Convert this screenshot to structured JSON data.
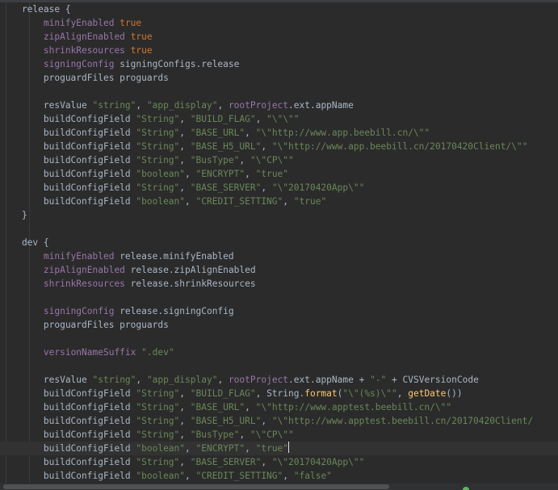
{
  "window": {
    "title": ""
  },
  "colors": {
    "background": "#2b2b2b",
    "default": "#a9b7c6",
    "keyword": "#cc7832",
    "property": "#9876aa",
    "string": "#6a8759",
    "method": "#ffc66d",
    "caret_line": "#323232"
  },
  "editor": {
    "active_line_index": 32,
    "lines": [
      [
        [
          "    release {",
          "default"
        ]
      ],
      [
        [
          "        ",
          "default"
        ],
        [
          "minifyEnabled",
          "property"
        ],
        [
          " ",
          "default"
        ],
        [
          "true",
          "keyword"
        ]
      ],
      [
        [
          "        ",
          "default"
        ],
        [
          "zipAlignEnabled",
          "property"
        ],
        [
          " ",
          "default"
        ],
        [
          "true",
          "keyword"
        ]
      ],
      [
        [
          "        ",
          "default"
        ],
        [
          "shrinkResources",
          "property"
        ],
        [
          " ",
          "default"
        ],
        [
          "true",
          "keyword"
        ]
      ],
      [
        [
          "        ",
          "default"
        ],
        [
          "signingConfig",
          "property"
        ],
        [
          " signingConfigs.release",
          "default"
        ]
      ],
      [
        [
          "        proguardFiles proguards",
          "default"
        ]
      ],
      [
        [
          "",
          "default"
        ]
      ],
      [
        [
          "        resValue ",
          "default"
        ],
        [
          "\"string\"",
          "string"
        ],
        [
          ", ",
          "default"
        ],
        [
          "\"app_display\"",
          "string"
        ],
        [
          ", ",
          "default"
        ],
        [
          "rootProject",
          "property"
        ],
        [
          ".ext.appName",
          "default"
        ]
      ],
      [
        [
          "        buildConfigField ",
          "default"
        ],
        [
          "\"String\"",
          "string"
        ],
        [
          ", ",
          "default"
        ],
        [
          "\"BUILD_FLAG\"",
          "string"
        ],
        [
          ", ",
          "default"
        ],
        [
          "\"\\\"\\\"\"",
          "string"
        ]
      ],
      [
        [
          "        buildConfigField ",
          "default"
        ],
        [
          "\"String\"",
          "string"
        ],
        [
          ", ",
          "default"
        ],
        [
          "\"BASE_URL\"",
          "string"
        ],
        [
          ", ",
          "default"
        ],
        [
          "\"\\\"http://www.app.beebill.cn/\\\"\"",
          "string"
        ]
      ],
      [
        [
          "        buildConfigField ",
          "default"
        ],
        [
          "\"String\"",
          "string"
        ],
        [
          ", ",
          "default"
        ],
        [
          "\"BASE_H5_URL\"",
          "string"
        ],
        [
          ", ",
          "default"
        ],
        [
          "\"\\\"http://www.app.beebill.cn/20170420Client/\\\"\"",
          "string"
        ]
      ],
      [
        [
          "        buildConfigField ",
          "default"
        ],
        [
          "\"String\"",
          "string"
        ],
        [
          ", ",
          "default"
        ],
        [
          "\"BusType\"",
          "string"
        ],
        [
          ", ",
          "default"
        ],
        [
          "\"\\\"CP\\\"\"",
          "string"
        ]
      ],
      [
        [
          "        buildConfigField ",
          "default"
        ],
        [
          "\"boolean\"",
          "string"
        ],
        [
          ", ",
          "default"
        ],
        [
          "\"ENCRYPT\"",
          "string"
        ],
        [
          ", ",
          "default"
        ],
        [
          "\"true\"",
          "string"
        ]
      ],
      [
        [
          "        buildConfigField ",
          "default"
        ],
        [
          "\"String\"",
          "string"
        ],
        [
          ", ",
          "default"
        ],
        [
          "\"BASE_SERVER\"",
          "string"
        ],
        [
          ", ",
          "default"
        ],
        [
          "\"\\\"20170420App\\\"\"",
          "string"
        ]
      ],
      [
        [
          "        buildConfigField ",
          "default"
        ],
        [
          "\"boolean\"",
          "string"
        ],
        [
          ", ",
          "default"
        ],
        [
          "\"CREDIT_SETTING\"",
          "string"
        ],
        [
          ", ",
          "default"
        ],
        [
          "\"true\"",
          "string"
        ]
      ],
      [
        [
          "    }",
          "default"
        ]
      ],
      [
        [
          "",
          "default"
        ]
      ],
      [
        [
          "    dev {",
          "default"
        ]
      ],
      [
        [
          "        ",
          "default"
        ],
        [
          "minifyEnabled",
          "property"
        ],
        [
          " release.minifyEnabled",
          "default"
        ]
      ],
      [
        [
          "        ",
          "default"
        ],
        [
          "zipAlignEnabled",
          "property"
        ],
        [
          " release.zipAlignEnabled",
          "default"
        ]
      ],
      [
        [
          "        ",
          "default"
        ],
        [
          "shrinkResources",
          "property"
        ],
        [
          " release.shrinkResources",
          "default"
        ]
      ],
      [
        [
          "",
          "default"
        ]
      ],
      [
        [
          "        ",
          "default"
        ],
        [
          "signingConfig",
          "property"
        ],
        [
          " release.signingConfig",
          "default"
        ]
      ],
      [
        [
          "        proguardFiles proguards",
          "default"
        ]
      ],
      [
        [
          "",
          "default"
        ]
      ],
      [
        [
          "        ",
          "default"
        ],
        [
          "versionNameSuffix",
          "property"
        ],
        [
          " ",
          "default"
        ],
        [
          "\".dev\"",
          "string"
        ]
      ],
      [
        [
          "",
          "default"
        ]
      ],
      [
        [
          "        resValue ",
          "default"
        ],
        [
          "\"string\"",
          "string"
        ],
        [
          ", ",
          "default"
        ],
        [
          "\"app_display\"",
          "string"
        ],
        [
          ", ",
          "default"
        ],
        [
          "rootProject",
          "property"
        ],
        [
          ".ext.appName + ",
          "default"
        ],
        [
          "\"-\"",
          "string"
        ],
        [
          " + CVSVersionCode",
          "default"
        ]
      ],
      [
        [
          "        buildConfigField ",
          "default"
        ],
        [
          "\"String\"",
          "string"
        ],
        [
          ", ",
          "default"
        ],
        [
          "\"BUILD_FLAG\"",
          "string"
        ],
        [
          ", String.",
          "default"
        ],
        [
          "format",
          "method"
        ],
        [
          "(",
          "default"
        ],
        [
          "\"\\\"(%s)\\\"\"",
          "string"
        ],
        [
          ", ",
          "default"
        ],
        [
          "getDate",
          "method"
        ],
        [
          "())",
          "default"
        ]
      ],
      [
        [
          "        buildConfigField ",
          "default"
        ],
        [
          "\"String\"",
          "string"
        ],
        [
          ", ",
          "default"
        ],
        [
          "\"BASE_URL\"",
          "string"
        ],
        [
          ", ",
          "default"
        ],
        [
          "\"\\\"http://www.apptest.beebill.cn/\\\"\"",
          "string"
        ]
      ],
      [
        [
          "        buildConfigField ",
          "default"
        ],
        [
          "\"String\"",
          "string"
        ],
        [
          ", ",
          "default"
        ],
        [
          "\"BASE_H5_URL\"",
          "string"
        ],
        [
          ", ",
          "default"
        ],
        [
          "\"\\\"http://www.apptest.beebill.cn/20170420Client/",
          "string"
        ]
      ],
      [
        [
          "        buildConfigField ",
          "default"
        ],
        [
          "\"String\"",
          "string"
        ],
        [
          ", ",
          "default"
        ],
        [
          "\"BusType\"",
          "string"
        ],
        [
          ", ",
          "default"
        ],
        [
          "\"\\\"CP\\\"\"",
          "string"
        ]
      ],
      [
        [
          "        buildConfigField ",
          "default"
        ],
        [
          "\"boolean\"",
          "string"
        ],
        [
          ", ",
          "default"
        ],
        [
          "\"ENCRYPT\"",
          "string"
        ],
        [
          ", ",
          "default"
        ],
        [
          "\"true\"",
          "string"
        ]
      ],
      [
        [
          "        buildConfigField ",
          "default"
        ],
        [
          "\"String\"",
          "string"
        ],
        [
          ", ",
          "default"
        ],
        [
          "\"BASE_SERVER\"",
          "string"
        ],
        [
          ", ",
          "default"
        ],
        [
          "\"\\\"20170420App\\\"\"",
          "string"
        ]
      ],
      [
        [
          "        buildConfigField ",
          "default"
        ],
        [
          "\"boolean\"",
          "string"
        ],
        [
          ", ",
          "default"
        ],
        [
          "\"CREDIT_SETTING\"",
          "string"
        ],
        [
          ", ",
          "default"
        ],
        [
          "\"false\"",
          "string"
        ]
      ]
    ]
  }
}
